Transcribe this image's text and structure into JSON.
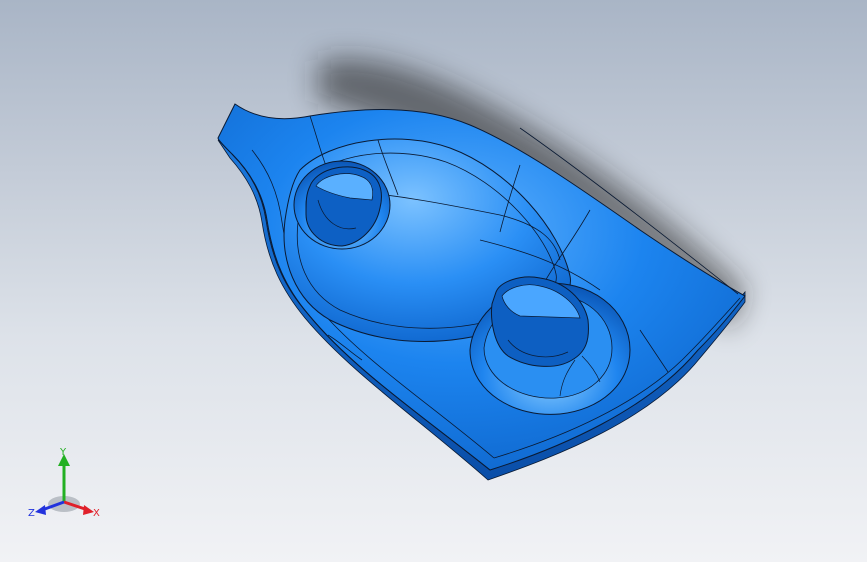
{
  "view": {
    "background_top": "#a9b5c6",
    "background_bottom": "#f1f2f5",
    "part_color": "#1e86f0",
    "edge_color": "#0a1a33"
  },
  "triad": {
    "x_label": "X",
    "y_label": "Y",
    "z_label": "Z",
    "x_color": "#e0202a",
    "y_color": "#22b022",
    "z_color": "#2233dd"
  }
}
